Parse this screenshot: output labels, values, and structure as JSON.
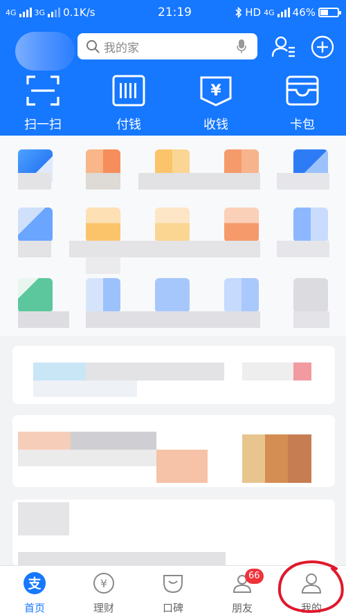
{
  "status_bar": {
    "net1": "4G",
    "net2": "3G",
    "speed": "0.1K/s",
    "time": "21:19",
    "hd": "HD",
    "net3": "4G",
    "battery": "46%",
    "battery_level": 0.46
  },
  "header": {
    "search_placeholder": "我的家",
    "quick_actions": [
      {
        "label": "扫一扫",
        "icon": "scan-icon"
      },
      {
        "label": "付钱",
        "icon": "pay-code-icon"
      },
      {
        "label": "收钱",
        "icon": "receive-money-icon"
      },
      {
        "label": "卡包",
        "icon": "card-wallet-icon"
      }
    ]
  },
  "tabbar": {
    "tabs": [
      {
        "label": "首页",
        "icon": "alipay-home-icon",
        "active": true
      },
      {
        "label": "理财",
        "icon": "yen-coin-icon",
        "active": false
      },
      {
        "label": "口碑",
        "icon": "koubei-icon",
        "active": false
      },
      {
        "label": "朋友",
        "icon": "friends-icon",
        "active": false,
        "badge": "66"
      },
      {
        "label": "我的",
        "icon": "person-icon",
        "active": false
      }
    ]
  },
  "colors": {
    "brand_blue": "#1677ff",
    "badge_red": "#f0323a",
    "annotation_red": "#e0182d"
  }
}
